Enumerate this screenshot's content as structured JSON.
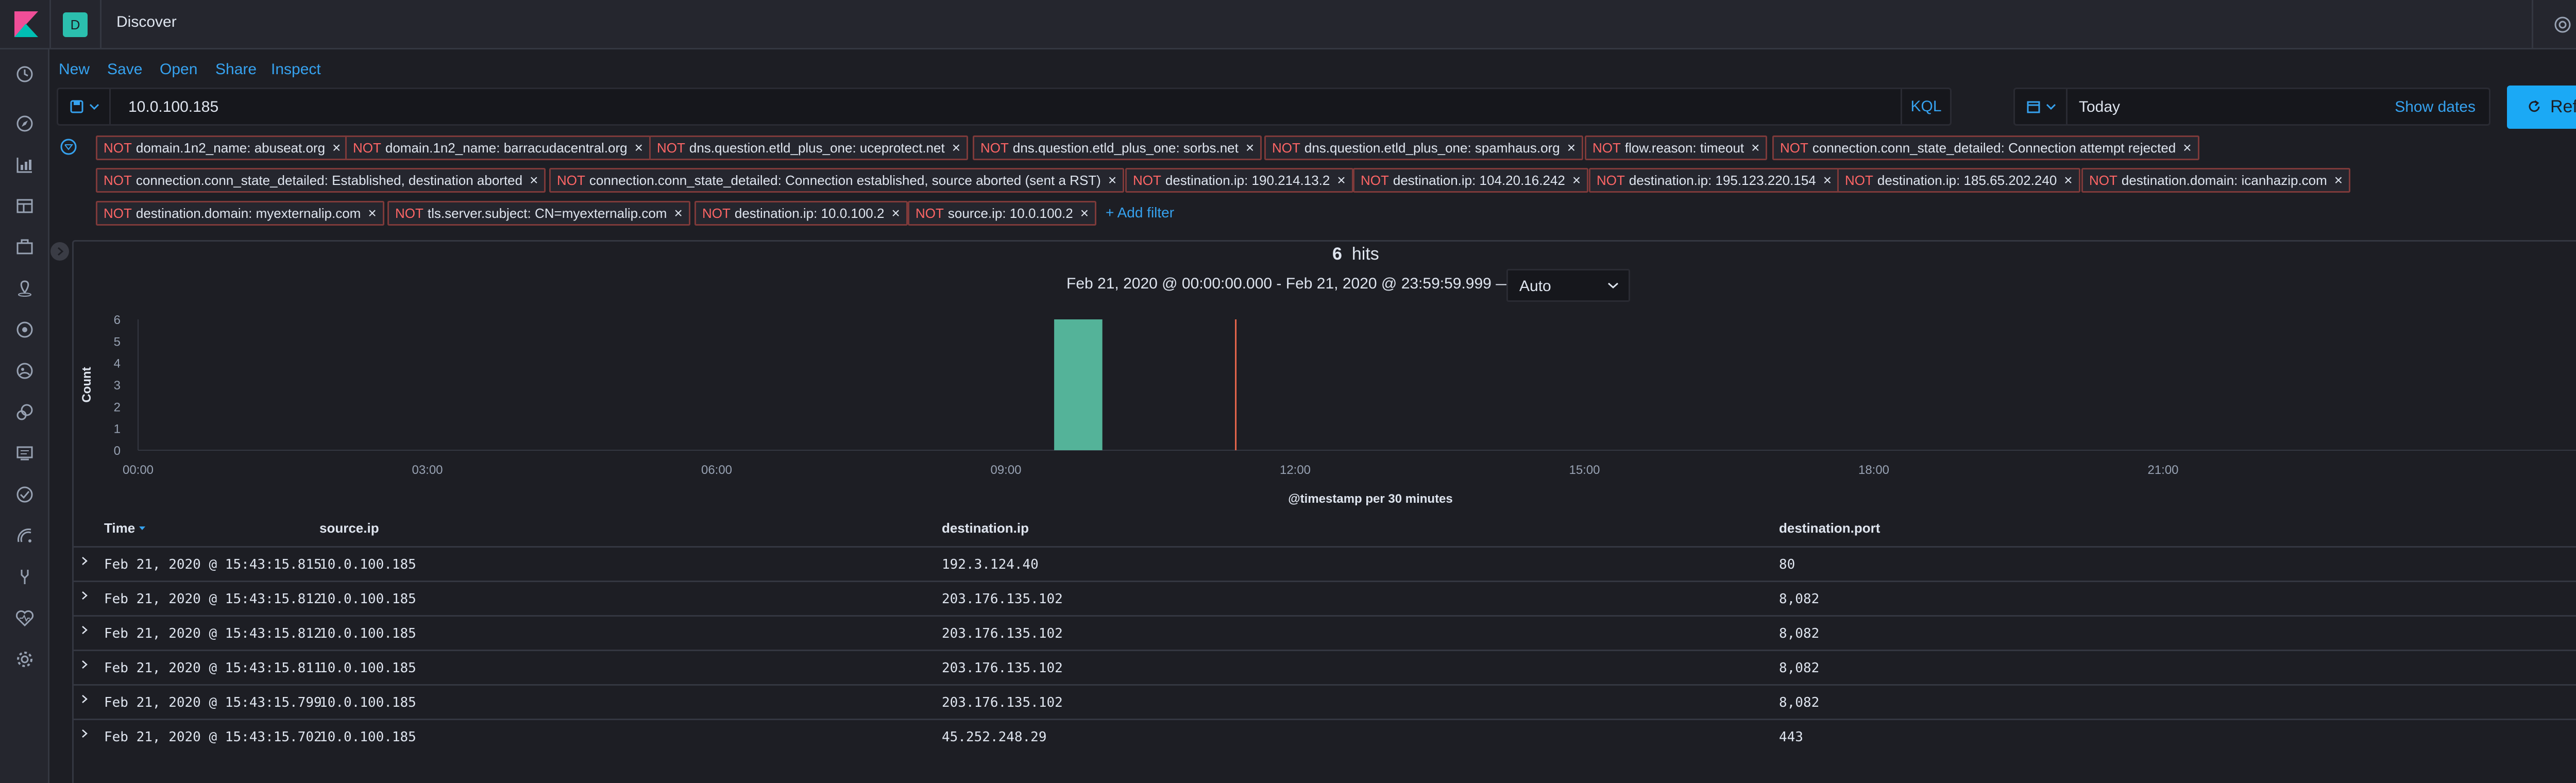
{
  "header": {
    "space_initial": "D",
    "app_title": "Discover",
    "icons": [
      "kibana-logo",
      "help-icon",
      "newsfeed-icon"
    ]
  },
  "left_nav": {
    "icons": [
      "clock-icon",
      "discover-icon",
      "visualize-icon",
      "dashboard-icon",
      "canvas-icon",
      "maps-icon",
      "ml-icon",
      "graph-icon",
      "siem-icon",
      "logs-icon",
      "apm-icon",
      "uptime-icon",
      "devtools-icon",
      "monitoring-icon",
      "management-icon"
    ]
  },
  "app_menu": {
    "new": "New",
    "save": "Save",
    "open": "Open",
    "share": "Share",
    "inspect": "Inspect"
  },
  "query": {
    "value": "10.0.100.185",
    "language": "KQL"
  },
  "date_picker": {
    "value": "Today",
    "show_dates": "Show dates"
  },
  "refresh": {
    "label": "Refresh",
    "color": "#1ba9f5"
  },
  "filters": {
    "negation": "NOT",
    "items": [
      "domain.1n2_name: abuseat.org",
      "domain.1n2_name: barracudacentral.org",
      "dns.question.etld_plus_one: uceprotect.net",
      "dns.question.etld_plus_one: sorbs.net",
      "dns.question.etld_plus_one: spamhaus.org",
      "flow.reason: timeout",
      "connection.conn_state_detailed: Connection attempt rejected",
      "connection.conn_state_detailed: Established, destination aborted",
      "connection.conn_state_detailed: Connection established, source aborted (sent a RST)",
      "destination.ip: 190.214.13.2",
      "destination.ip: 104.20.16.242",
      "destination.ip: 195.123.220.154",
      "destination.ip: 185.65.202.240",
      "destination.domain: icanhazip.com",
      "destination.domain: myexternalip.com",
      "tls.server.subject: CN=myexternalip.com",
      "destination.ip: 10.0.100.2",
      "source.ip: 10.0.100.2"
    ],
    "add_filter": "+ Add filter"
  },
  "results": {
    "hits_count": "6",
    "hits_label": "hits",
    "time_range": "Feb 21, 2020 @ 00:00:00.000 - Feb 21, 2020 @ 23:59:59.999 —",
    "interval": "Auto"
  },
  "chart_data": {
    "type": "bar",
    "title": "",
    "xlabel": "@timestamp per 30 minutes",
    "ylabel": "Count",
    "x_ticks": [
      "00:00",
      "03:00",
      "06:00",
      "09:00",
      "12:00",
      "15:00",
      "18:00",
      "21:00"
    ],
    "y_ticks": [
      "0",
      "1",
      "2",
      "3",
      "4",
      "5",
      "6"
    ],
    "ylim": [
      0,
      6
    ],
    "x_range_hours": [
      0,
      24
    ],
    "bars": [
      {
        "bucket_start": "09:30",
        "value": 6
      }
    ],
    "now_marker": "11:23",
    "bar_color": "#54b399",
    "marker_color": "#e7664c"
  },
  "table": {
    "columns": [
      "Time",
      "source.ip",
      "destination.ip",
      "destination.port"
    ],
    "rows": [
      [
        "Feb 21, 2020 @ 15:43:15.815",
        "10.0.100.185",
        "192.3.124.40",
        "80"
      ],
      [
        "Feb 21, 2020 @ 15:43:15.812",
        "10.0.100.185",
        "203.176.135.102",
        "8,082"
      ],
      [
        "Feb 21, 2020 @ 15:43:15.812",
        "10.0.100.185",
        "203.176.135.102",
        "8,082"
      ],
      [
        "Feb 21, 2020 @ 15:43:15.811",
        "10.0.100.185",
        "203.176.135.102",
        "8,082"
      ],
      [
        "Feb 21, 2020 @ 15:43:15.799",
        "10.0.100.185",
        "203.176.135.102",
        "8,082"
      ],
      [
        "Feb 21, 2020 @ 15:43:15.702",
        "10.0.100.185",
        "45.252.248.29",
        "443"
      ]
    ]
  }
}
